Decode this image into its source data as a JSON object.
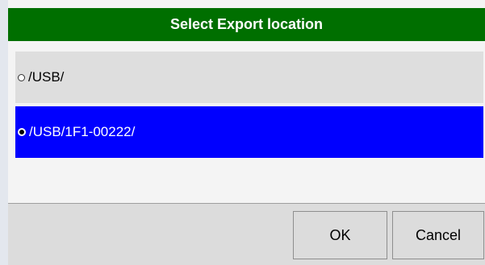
{
  "dialog": {
    "title": "Select Export location",
    "options": [
      {
        "label": "/USB/",
        "selected": false
      },
      {
        "label": "/USB/1F1-00222/",
        "selected": true
      }
    ],
    "ok_label": "OK",
    "cancel_label": "Cancel"
  },
  "colors": {
    "title_bar": "#006f00",
    "selected_row": "#0000ff",
    "unselected_row": "#dedede",
    "footer": "#dcdcdc"
  },
  "icons": {
    "unselected_radio": "radio-unselected-icon",
    "selected_radio": "radio-selected-icon"
  }
}
